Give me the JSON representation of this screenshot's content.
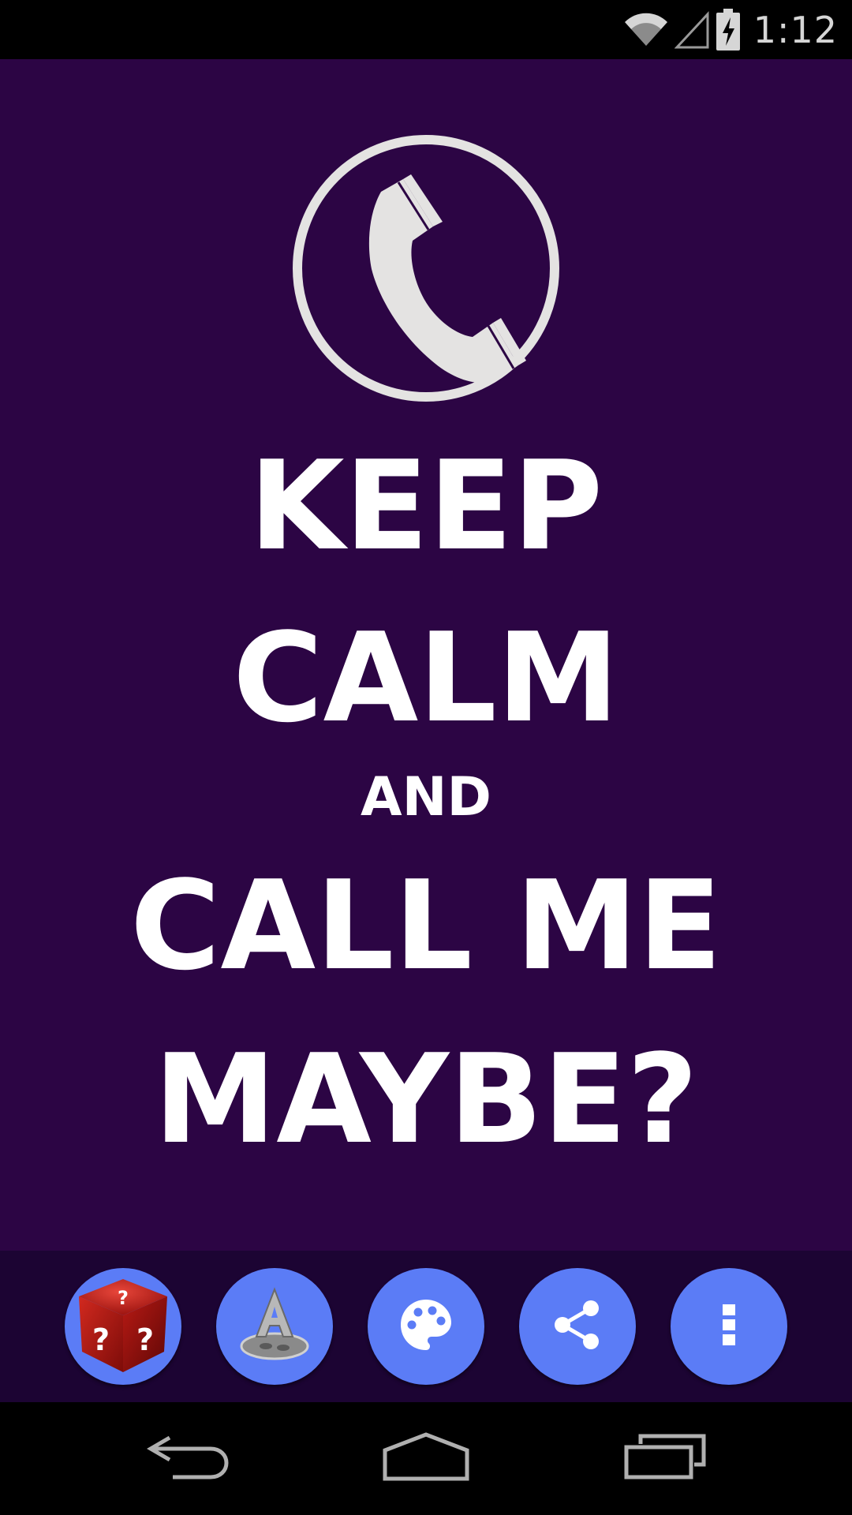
{
  "status_bar": {
    "time": "1:12",
    "icons": [
      "wifi-icon",
      "cell-signal-icon",
      "battery-charging-icon"
    ]
  },
  "poster": {
    "background_color": "#2c0544",
    "emblem_icon": "phone-handset-icon",
    "lines": [
      "KEEP",
      "CALM",
      "AND",
      "CALL ME",
      "MAYBE?"
    ]
  },
  "toolbar": {
    "background_color": "#1c0433",
    "button_color": "#5b7cf6",
    "buttons": [
      {
        "icon": "random-dice-icon"
      },
      {
        "icon": "font-icon"
      },
      {
        "icon": "palette-icon"
      },
      {
        "icon": "share-icon"
      },
      {
        "icon": "more-vert-icon"
      }
    ]
  },
  "nav_bar": {
    "buttons": [
      {
        "icon": "back-icon"
      },
      {
        "icon": "home-icon"
      },
      {
        "icon": "recents-icon"
      }
    ]
  }
}
